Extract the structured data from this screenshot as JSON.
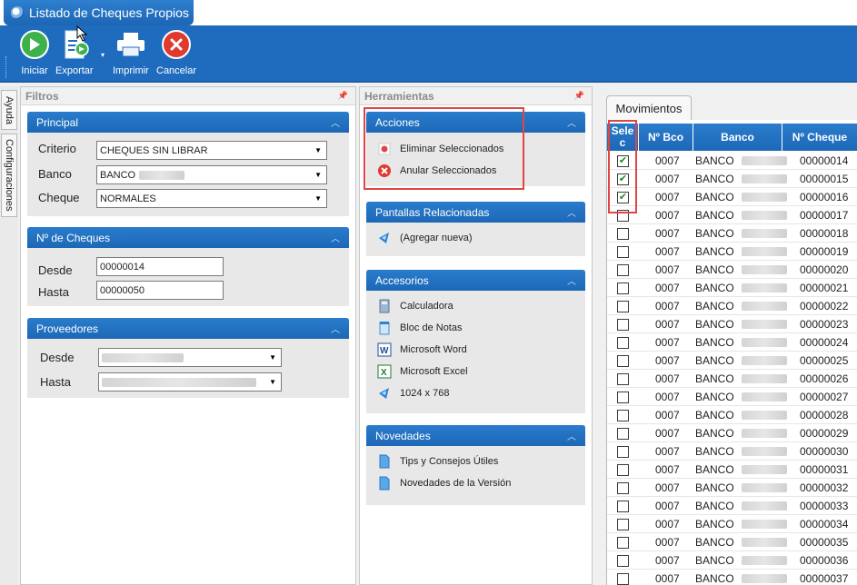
{
  "window": {
    "title": "Listado de Cheques Propios"
  },
  "toolbar": {
    "iniciar": "Iniciar",
    "exportar": "Exportar",
    "imprimir": "Imprimir",
    "cancelar": "Cancelar"
  },
  "side_tabs": {
    "ayuda": "Ayuda",
    "configuraciones": "Configuraciones"
  },
  "filtros": {
    "title": "Filtros",
    "principal": {
      "title": "Principal",
      "criterio_label": "Criterio",
      "criterio_value": "CHEQUES SIN LIBRAR",
      "banco_label": "Banco",
      "banco_value": "BANCO",
      "cheque_label": "Cheque",
      "cheque_value": "NORMALES"
    },
    "nro_cheques": {
      "title": "Nº de Cheques",
      "desde_label": "Desde",
      "desde_value": "00000014",
      "hasta_label": "Hasta",
      "hasta_value": "00000050"
    },
    "proveedores": {
      "title": "Proveedores",
      "desde_label": "Desde",
      "hasta_label": "Hasta"
    }
  },
  "herramientas": {
    "title": "Herramientas",
    "acciones": {
      "title": "Acciones",
      "items": [
        "Eliminar Seleccionados",
        "Anular Seleccionados"
      ]
    },
    "pantallas": {
      "title": "Pantallas Relacionadas",
      "items": [
        "(Agregar nueva)"
      ]
    },
    "accesorios": {
      "title": "Accesorios",
      "items": [
        "Calculadora",
        "Bloc de Notas",
        "Microsoft Word",
        "Microsoft Excel",
        "1024 x 768"
      ]
    },
    "novedades": {
      "title": "Novedades",
      "items": [
        "Tips y Consejos Útiles",
        "Novedades de la Versión"
      ]
    }
  },
  "movimientos": {
    "tab_label": "Movimientos",
    "columns": [
      "Selec",
      "Nº Bco",
      "Banco",
      "Nº Cheque"
    ],
    "rows": [
      {
        "sel": true,
        "bco": "0007",
        "banco": "BANCO",
        "cheque": "00000014"
      },
      {
        "sel": true,
        "bco": "0007",
        "banco": "BANCO",
        "cheque": "00000015"
      },
      {
        "sel": true,
        "bco": "0007",
        "banco": "BANCO",
        "cheque": "00000016"
      },
      {
        "sel": false,
        "bco": "0007",
        "banco": "BANCO",
        "cheque": "00000017"
      },
      {
        "sel": false,
        "bco": "0007",
        "banco": "BANCO",
        "cheque": "00000018"
      },
      {
        "sel": false,
        "bco": "0007",
        "banco": "BANCO",
        "cheque": "00000019"
      },
      {
        "sel": false,
        "bco": "0007",
        "banco": "BANCO",
        "cheque": "00000020"
      },
      {
        "sel": false,
        "bco": "0007",
        "banco": "BANCO",
        "cheque": "00000021"
      },
      {
        "sel": false,
        "bco": "0007",
        "banco": "BANCO",
        "cheque": "00000022"
      },
      {
        "sel": false,
        "bco": "0007",
        "banco": "BANCO",
        "cheque": "00000023"
      },
      {
        "sel": false,
        "bco": "0007",
        "banco": "BANCO",
        "cheque": "00000024"
      },
      {
        "sel": false,
        "bco": "0007",
        "banco": "BANCO",
        "cheque": "00000025"
      },
      {
        "sel": false,
        "bco": "0007",
        "banco": "BANCO",
        "cheque": "00000026"
      },
      {
        "sel": false,
        "bco": "0007",
        "banco": "BANCO",
        "cheque": "00000027"
      },
      {
        "sel": false,
        "bco": "0007",
        "banco": "BANCO",
        "cheque": "00000028"
      },
      {
        "sel": false,
        "bco": "0007",
        "banco": "BANCO",
        "cheque": "00000029"
      },
      {
        "sel": false,
        "bco": "0007",
        "banco": "BANCO",
        "cheque": "00000030"
      },
      {
        "sel": false,
        "bco": "0007",
        "banco": "BANCO",
        "cheque": "00000031"
      },
      {
        "sel": false,
        "bco": "0007",
        "banco": "BANCO",
        "cheque": "00000032"
      },
      {
        "sel": false,
        "bco": "0007",
        "banco": "BANCO",
        "cheque": "00000033"
      },
      {
        "sel": false,
        "bco": "0007",
        "banco": "BANCO",
        "cheque": "00000034"
      },
      {
        "sel": false,
        "bco": "0007",
        "banco": "BANCO",
        "cheque": "00000035"
      },
      {
        "sel": false,
        "bco": "0007",
        "banco": "BANCO",
        "cheque": "00000036"
      },
      {
        "sel": false,
        "bco": "0007",
        "banco": "BANCO",
        "cheque": "00000037"
      }
    ]
  },
  "colors": {
    "accent": "#1f6cbf",
    "header": "#2a7ccc",
    "highlight": "#e04545",
    "check": "#1f8a2a"
  }
}
